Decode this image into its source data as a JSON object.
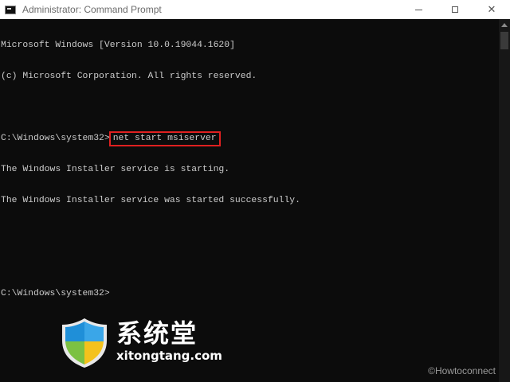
{
  "window": {
    "title": "Administrator: Command Prompt",
    "controls": {
      "minimize": "–",
      "maximize": "□",
      "close": "✕"
    }
  },
  "console": {
    "lines": [
      "Microsoft Windows [Version 10.0.19044.1620]",
      "(c) Microsoft Corporation. All rights reserved.",
      "",
      "",
      "The Windows Installer service is starting.",
      "The Windows Installer service was started successfully.",
      "",
      "",
      "C:\\Windows\\system32>"
    ],
    "prompt": "C:\\Windows\\system32>",
    "command": "net start msiserver"
  },
  "watermark": {
    "title": "系统堂",
    "url": "xitongtang.com"
  },
  "credit": "©Howtoconnect",
  "colors": {
    "console_bg": "#0c0c0c",
    "console_text": "#cccccc",
    "highlight_box": "#e02020",
    "titlebar_bg": "#ffffff"
  },
  "icons": [
    "cmd-app-icon",
    "minimize-icon",
    "maximize-icon",
    "close-icon",
    "scroll-up-arrow-icon",
    "shield-logo-icon"
  ]
}
